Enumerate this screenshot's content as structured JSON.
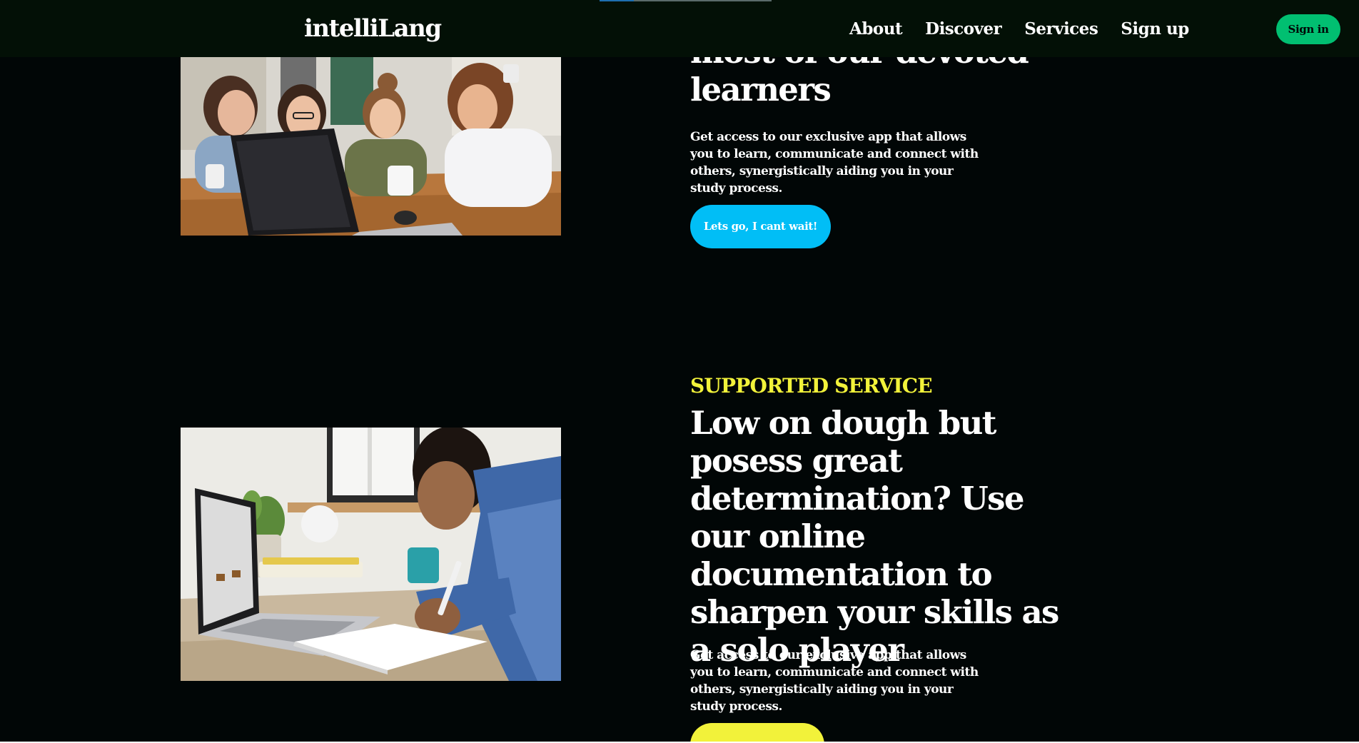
{
  "navbar": {
    "logo": "intelliLang",
    "links": [
      {
        "label": "About"
      },
      {
        "label": "Discover"
      },
      {
        "label": "Services"
      },
      {
        "label": "Sign up"
      }
    ],
    "signin_label": "Sign in",
    "signin_color": "#01bf71"
  },
  "section1": {
    "heading": "most of our devoted learners",
    "description": "Get access to our exclusive app that allows you to learn, communicate and connect with others, synergistically aiding you in your study process.",
    "button_label": "Lets go, I cant wait!",
    "button_color": "#01bef6"
  },
  "section2": {
    "eyebrow": "SUPPORTED SERVICE",
    "eyebrow_color": "#f2f23a",
    "heading": "Low on dough but posess great determination? Use our online documentation to sharpen your skills as a solo player",
    "description": "Get access to our exclusive app that allows you to learn, communicate and connect with others, synergistically aiding you in your study process.",
    "button_color": "#f2f23a"
  },
  "colors": {
    "page_background": "#010606",
    "navbar_background": "#031006"
  }
}
